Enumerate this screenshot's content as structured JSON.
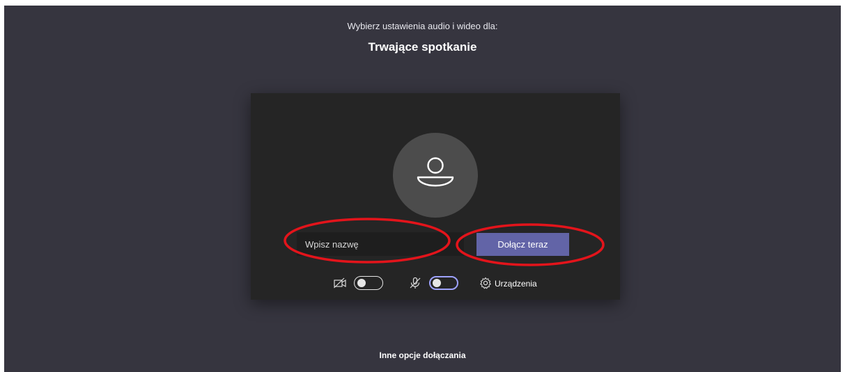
{
  "header": {
    "subtitle": "Wybierz ustawienia audio i wideo dla:",
    "meeting_title": "Trwające spotkanie"
  },
  "prejoin": {
    "name_placeholder": "Wpisz nazwę",
    "name_value": "",
    "join_label": "Dołącz teraz",
    "camera_toggle": {
      "state": "off",
      "icon": "camera-off-icon"
    },
    "mic_toggle": {
      "state": "off",
      "icon": "mic-off-icon"
    },
    "devices_label": "Urządzenia",
    "devices_icon": "gear-icon"
  },
  "footer": {
    "other_options_label": "Inne opcje dołączania"
  },
  "colors": {
    "background": "#36353f",
    "panel": "#252525",
    "accent": "#6264a7",
    "annotation": "#e3141b"
  }
}
